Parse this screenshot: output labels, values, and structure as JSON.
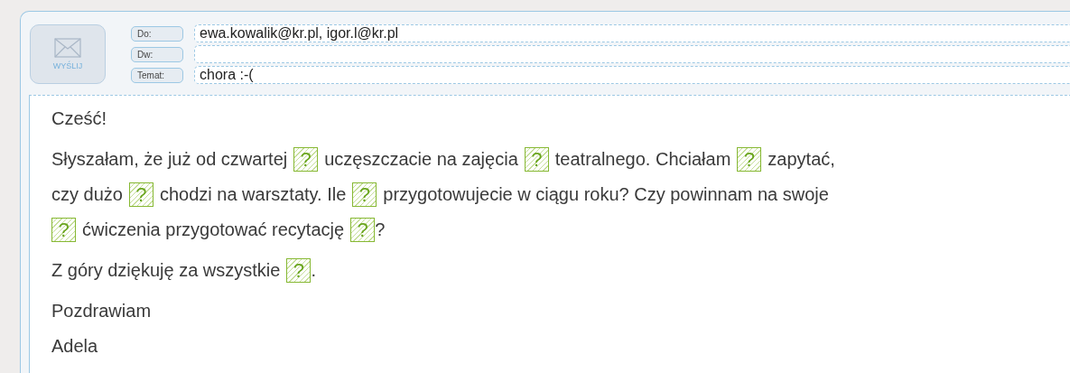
{
  "send_button": {
    "label": "WYŚLIJ"
  },
  "fields": [
    {
      "label": "Do:",
      "value": "ewa.kowalik@kr.pl, igor.l@kr.pl"
    },
    {
      "label": "Dw:"
    },
    {
      "label": "Temat:",
      "value": "chora :-("
    }
  ],
  "body": {
    "paragraphs": [
      {
        "lines": [
          [
            {
              "kind": "text",
              "text": "Cześć!"
            }
          ]
        ]
      },
      {
        "lines": [
          [
            {
              "kind": "text",
              "text": "Słyszałam, że już od czwartej"
            },
            {
              "kind": "gap",
              "text": "?"
            },
            {
              "kind": "text",
              "text": "uczęszczacie na zajęcia"
            },
            {
              "kind": "gap",
              "text": "?"
            },
            {
              "kind": "text",
              "text": "teatralnego. Chciałam"
            },
            {
              "kind": "gap",
              "text": "?"
            },
            {
              "kind": "text",
              "text": "zapytać,"
            }
          ],
          [
            {
              "kind": "text",
              "text": "czy dużo"
            },
            {
              "kind": "gap",
              "text": "?"
            },
            {
              "kind": "text",
              "text": "chodzi na warsztaty. Ile"
            },
            {
              "kind": "gap",
              "text": "?"
            },
            {
              "kind": "text",
              "text": "przygotowujecie w ciągu roku? Czy powinnam na swoje"
            }
          ],
          [
            {
              "kind": "gap",
              "text": "?"
            },
            {
              "kind": "text",
              "text": "ćwiczenia przygotować recytację"
            },
            {
              "kind": "gap",
              "text": "?"
            },
            {
              "kind": "tail",
              "text": "?"
            }
          ]
        ]
      },
      {
        "lines": [
          [
            {
              "kind": "text",
              "text": "Z góry dziękuję za wszystkie"
            },
            {
              "kind": "gap",
              "text": "?"
            },
            {
              "kind": "tail",
              "text": "."
            }
          ]
        ]
      },
      {
        "lines": [
          [
            {
              "kind": "text",
              "text": "Pozdrawiam"
            }
          ],
          [
            {
              "kind": "text",
              "text": "Adela"
            }
          ]
        ]
      }
    ]
  }
}
